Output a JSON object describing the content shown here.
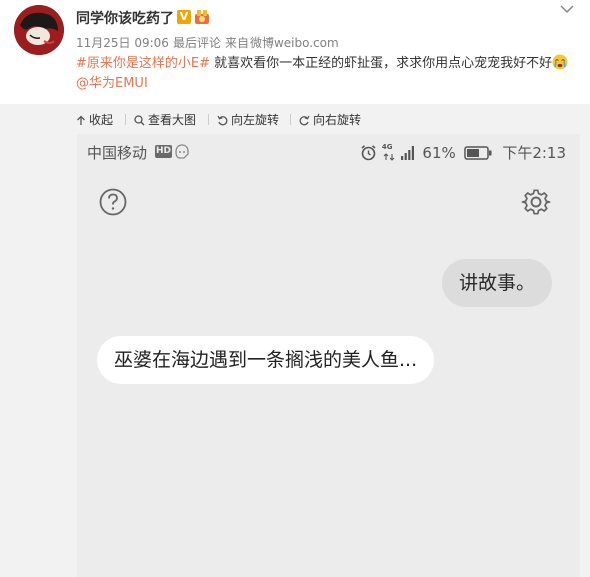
{
  "post": {
    "username": "同学你该吃药了",
    "verified_badge": "V",
    "date": "11月25日 09:06",
    "last_comment": "最后评论",
    "source_prefix": "来自",
    "source": "微博weibo.com",
    "hashtag": "#原来你是这样的小E#",
    "body_text": " 就喜欢看你一本正经的虾扯蛋，求求你用点心宠宠我好不好",
    "mention": "@华为EMUI",
    "colors": {
      "link": "#eb7350",
      "verified": "#f2a500"
    }
  },
  "toolbar": {
    "collapse": "收起",
    "view_large": "查看大图",
    "rotate_left": "向左旋转",
    "rotate_right": "向右旋转"
  },
  "phone": {
    "carrier": "中国移动",
    "hd": "HD",
    "network": "4G",
    "battery": "61%",
    "time": "下午2:13",
    "user_message": "讲故事。",
    "assistant_message": "巫婆在海边遇到一条搁浅的美人鱼..."
  }
}
